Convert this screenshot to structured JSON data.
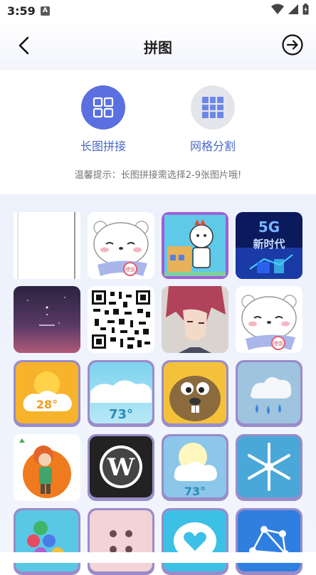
{
  "status_bar": {
    "time": "3:59",
    "notification_letter": "A"
  },
  "header": {
    "title": "拼图"
  },
  "modes": [
    {
      "label": "长图拼接",
      "icon": "grid-2x2-icon",
      "selected": true
    },
    {
      "label": "网格分割",
      "icon": "grid-3x3-icon",
      "selected": false
    }
  ],
  "hint": "温馨提示：长图拼接需选择2-9张图片哦!",
  "colors": {
    "accent": "#5a6fe0",
    "label": "#4a68c6",
    "background": "#eef2fb"
  },
  "thumbnail_texts": {
    "five_g_label": "5G",
    "five_g_sub": "新时代",
    "weather_temp_1": "28°",
    "weather_temp_2": "73°",
    "weather_temp_3": "73°",
    "bear_badge": "喂饭"
  },
  "photos": [
    {
      "name": "blank-white-photo"
    },
    {
      "name": "polar-bear-sticker-photo"
    },
    {
      "name": "cartoon-robot-photo"
    },
    {
      "name": "5g-era-photo"
    },
    {
      "name": "night-sky-album-photo"
    },
    {
      "name": "qr-code-photo"
    },
    {
      "name": "anime-boy-photo"
    },
    {
      "name": "polar-bear-sticker-photo-2"
    },
    {
      "name": "sunny-weather-icon-photo"
    },
    {
      "name": "cloudy-weather-icon-photo"
    },
    {
      "name": "beaver-game-icon-photo"
    },
    {
      "name": "rain-cloud-icon-photo"
    },
    {
      "name": "autumn-boy-photo"
    },
    {
      "name": "wordpress-icon-photo"
    },
    {
      "name": "partly-cloudy-icon-photo"
    },
    {
      "name": "snowflake-icon-photo"
    },
    {
      "name": "bubble-game-icon-photo"
    },
    {
      "name": "dice-icon-photo"
    },
    {
      "name": "heart-chat-icon-photo"
    },
    {
      "name": "network-icon-photo"
    }
  ]
}
